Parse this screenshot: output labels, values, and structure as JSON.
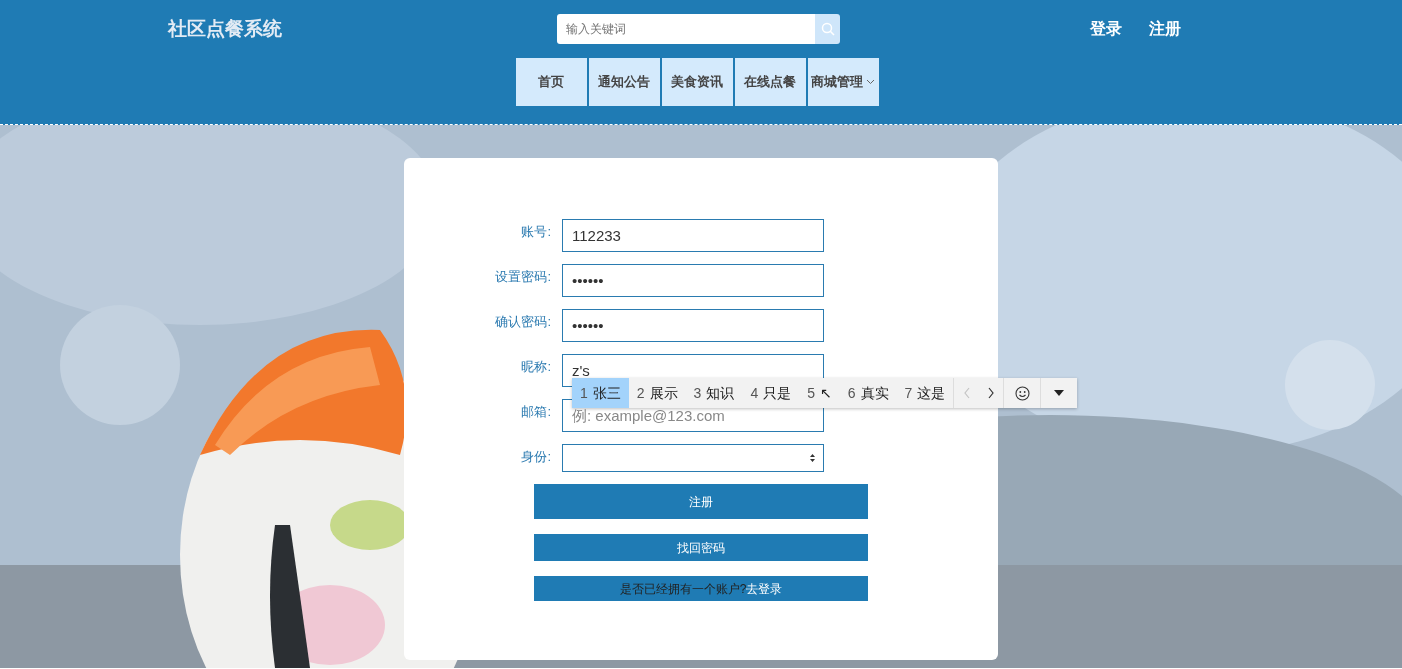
{
  "header": {
    "title": "社区点餐系统",
    "search": {
      "placeholder": "输入关键词"
    },
    "auth_links": [
      "登录",
      "注册"
    ]
  },
  "nav": [
    {
      "label": "首页",
      "kind": "link"
    },
    {
      "label": "通知公告",
      "kind": "link"
    },
    {
      "label": "美食资讯",
      "kind": "link"
    },
    {
      "label": "在线点餐",
      "kind": "link"
    },
    {
      "label": "商城管理",
      "kind": "dropdown"
    }
  ],
  "form": {
    "fields": [
      {
        "label": "账号:",
        "kind": "text",
        "value": "112233"
      },
      {
        "label": "设置密码:",
        "kind": "text",
        "value": "••••••"
      },
      {
        "label": "确认密码:",
        "kind": "text",
        "value": "••••••"
      },
      {
        "label": "昵称:",
        "kind": "text",
        "value": "z's"
      },
      {
        "label": "邮箱:",
        "kind": "text",
        "placeholder": "例: example@123.com"
      },
      {
        "label": "身份:",
        "kind": "select"
      }
    ],
    "register_button": "注册",
    "recover_button": "找回密码",
    "login_prompt": {
      "text": "是否已经拥有一个账户?",
      "link": "去登录"
    }
  },
  "ime": {
    "candidates": [
      {
        "index": "1",
        "text": "张三",
        "selected": true
      },
      {
        "index": "2",
        "text": "展示",
        "selected": false
      },
      {
        "index": "3",
        "text": "知识",
        "selected": false
      },
      {
        "index": "4",
        "text": "只是",
        "selected": false
      },
      {
        "index": "5",
        "text": "↖",
        "selected": false
      },
      {
        "index": "6",
        "text": "真实",
        "selected": false
      },
      {
        "index": "7",
        "text": "这是",
        "selected": false
      }
    ],
    "prev_disabled": true,
    "next_disabled": false
  }
}
